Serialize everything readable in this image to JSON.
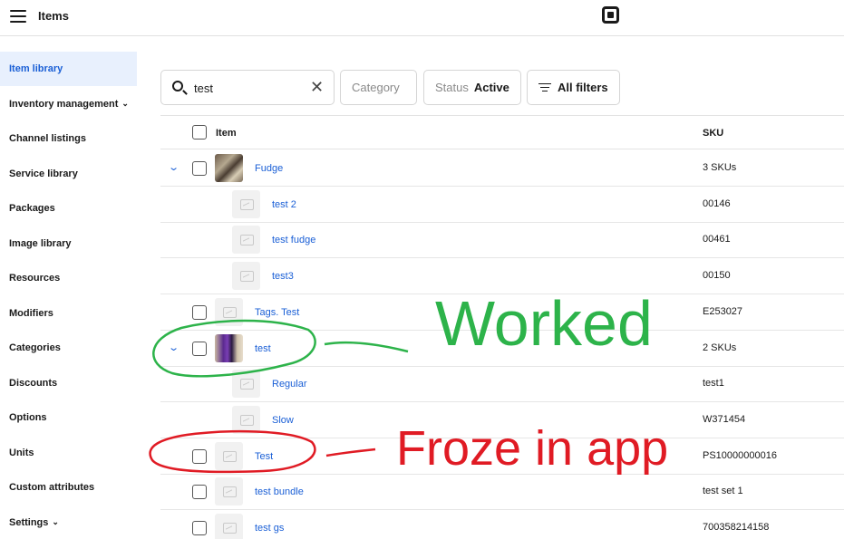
{
  "header": {
    "title": "Items",
    "menu_icon": "hamburger-menu-icon",
    "logo_icon": "square-logo-icon"
  },
  "sidebar": {
    "items": [
      {
        "label": "Item library",
        "active": true
      },
      {
        "label": "Inventory management",
        "has_chevron": true
      },
      {
        "label": "Channel listings"
      },
      {
        "label": "Service library"
      },
      {
        "label": "Packages"
      },
      {
        "label": "Image library"
      },
      {
        "label": "Resources"
      },
      {
        "label": "Modifiers"
      },
      {
        "label": "Categories"
      },
      {
        "label": "Discounts"
      },
      {
        "label": "Options"
      },
      {
        "label": "Units"
      },
      {
        "label": "Custom attributes"
      },
      {
        "label": "Settings",
        "has_chevron": true
      }
    ],
    "chevron_glyph": "⌄"
  },
  "toolbar": {
    "search": {
      "value": "test",
      "icon": "search-icon",
      "clear_icon": "close-icon"
    },
    "category_placeholder": "Category",
    "status_label": "Status",
    "status_value": "Active",
    "all_filters_label": "All filters"
  },
  "table": {
    "columns": {
      "item": "Item",
      "sku": "SKU"
    },
    "rows": [
      {
        "name": "Fudge",
        "sku": "3 SKUs",
        "level": 0,
        "expandable": true,
        "thumb": "photo-fudge"
      },
      {
        "name": "test 2",
        "sku": "00146",
        "level": 1,
        "thumb": "placeholder"
      },
      {
        "name": "test fudge",
        "sku": "00461",
        "level": 1,
        "thumb": "placeholder"
      },
      {
        "name": "test3",
        "sku": "00150",
        "level": 1,
        "thumb": "placeholder"
      },
      {
        "name": "Tags. Test",
        "sku": "E253027",
        "level": 0,
        "thumb": "placeholder"
      },
      {
        "name": "test",
        "sku": "2 SKUs",
        "level": 0,
        "expandable": true,
        "thumb": "photo-test"
      },
      {
        "name": "Regular",
        "sku": "test1",
        "level": 1,
        "thumb": "placeholder"
      },
      {
        "name": "Slow",
        "sku": "W371454",
        "level": 1,
        "thumb": "placeholder"
      },
      {
        "name": "Test",
        "sku": "PS10000000016",
        "level": 0,
        "thumb": "placeholder"
      },
      {
        "name": "test bundle",
        "sku": "test set 1",
        "level": 0,
        "thumb": "placeholder"
      },
      {
        "name": "test gs",
        "sku": "700358214158",
        "level": 0,
        "thumb": "placeholder"
      }
    ],
    "expand_glyph": "⌄"
  },
  "annotations": {
    "worked": {
      "text": "Worked",
      "color": "#2db34a"
    },
    "froze": {
      "text": "Froze in app",
      "color": "#e01b24"
    }
  }
}
